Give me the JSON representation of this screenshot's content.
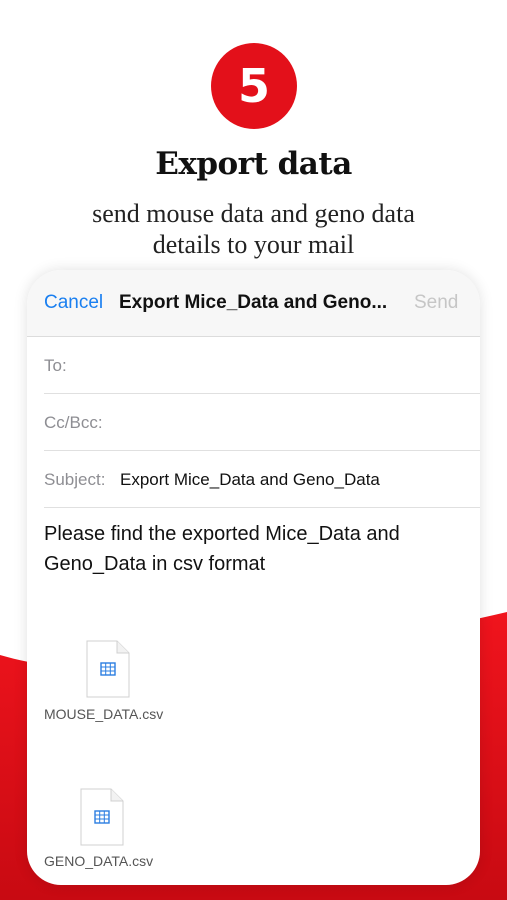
{
  "step": {
    "number": "5",
    "color": "#e3101a"
  },
  "headline": "Export data",
  "subline": "send mouse data and geno data details to your mail",
  "mail": {
    "cancel_label": "Cancel",
    "title": "Export Mice_Data and Geno...",
    "send_label": "Send",
    "to_label": "To:",
    "ccbcc_label": "Cc/Bcc:",
    "subject_label": "Subject:",
    "subject_value": "Export Mice_Data and Geno_Data",
    "body": "Please find the exported Mice_Data and Geno_Data in csv format",
    "attachments": [
      {
        "name": "MOUSE_DATA.csv",
        "icon": "spreadsheet-file-icon"
      },
      {
        "name": "GENO_DATA.csv",
        "icon": "spreadsheet-file-icon"
      }
    ]
  },
  "colors": {
    "accent_blue": "#1a7ff0",
    "brand_red": "#e3101a"
  }
}
